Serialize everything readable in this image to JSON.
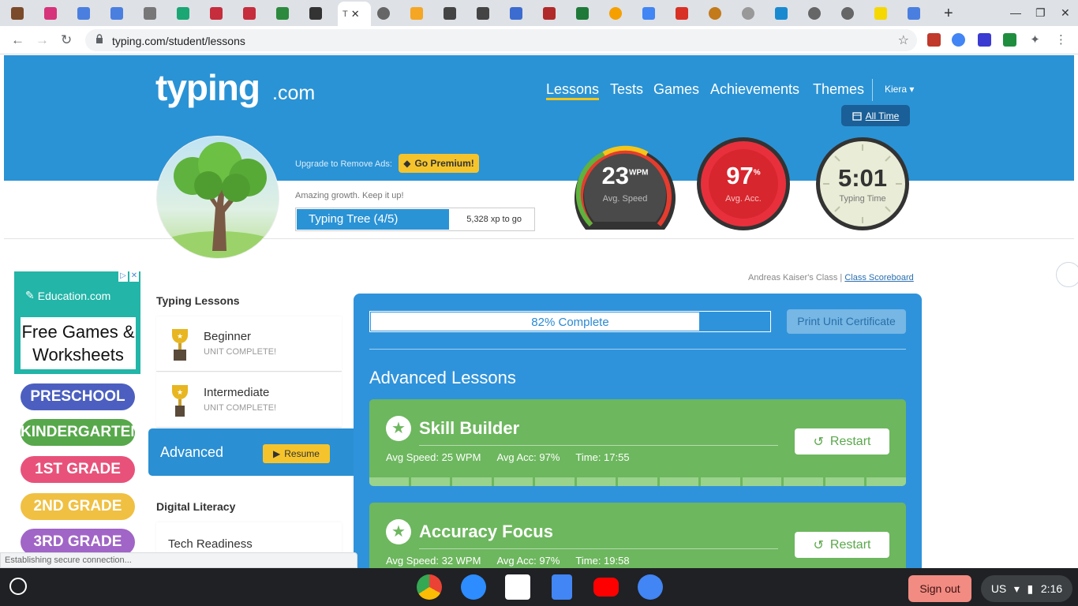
{
  "browser": {
    "active_tab_title": "T",
    "url": "typing.com/student/lessons",
    "status_text": "Establishing secure connection..."
  },
  "site": {
    "logo": "typing",
    "logo_suffix": ".com",
    "nav": [
      "Lessons",
      "Tests",
      "Games",
      "Achievements",
      "Themes"
    ],
    "user": "Kiera",
    "range": "All Time",
    "upgrade_text": "Upgrade to Remove Ads:",
    "premium_label": "Go Premium!",
    "growth_text": "Amazing growth. Keep it up!",
    "tree_label": "Typing Tree (4/5)",
    "tree_progress": 0.64,
    "xp_to_go": "5,328 xp to go"
  },
  "stats": {
    "speed": {
      "value": "23",
      "unit": "WPM",
      "label": "Avg. Speed"
    },
    "accuracy": {
      "value": "97",
      "unit": "%",
      "label": "Avg. Acc."
    },
    "time": {
      "value": "5:01",
      "label": "Typing Time"
    }
  },
  "ad": {
    "brand": "Education.com",
    "headline": "Free Games & Worksheets",
    "grades": [
      {
        "label": "PRESCHOOL",
        "color": "#4c5fc0"
      },
      {
        "label": "KINDERGARTEN",
        "color": "#57a84b"
      },
      {
        "label": "1ST GRADE",
        "color": "#e8527a"
      },
      {
        "label": "2ND GRADE",
        "color": "#f0c042"
      },
      {
        "label": "3RD GRADE",
        "color": "#a065c6"
      }
    ]
  },
  "sidebar": {
    "typing_title": "Typing Lessons",
    "units": [
      {
        "name": "Beginner",
        "status": "UNIT COMPLETE!"
      },
      {
        "name": "Intermediate",
        "status": "UNIT COMPLETE!"
      }
    ],
    "active_unit": "Advanced",
    "resume_label": "Resume",
    "digital_title": "Digital Literacy",
    "digital_items": [
      "Tech Readiness"
    ]
  },
  "class": {
    "name": "Andreas Kaiser's Class |",
    "scoreboard_link": "Class Scoreboard"
  },
  "main": {
    "progress_text": "82% Complete",
    "progress": 0.82,
    "cert_label": "Print Unit Certificate",
    "title": "Advanced Lessons",
    "lessons": [
      {
        "name": "Skill Builder",
        "speed": "Avg Speed: 25 WPM",
        "acc": "Avg Acc: 97%",
        "time": "Time: 17:55",
        "action": "Restart"
      },
      {
        "name": "Accuracy Focus",
        "speed": "Avg Speed: 32 WPM",
        "acc": "Avg Acc: 97%",
        "time": "Time: 19:58",
        "action": "Restart"
      }
    ]
  },
  "shelf": {
    "signout": "Sign out",
    "locale": "US",
    "clock": "2:16"
  }
}
